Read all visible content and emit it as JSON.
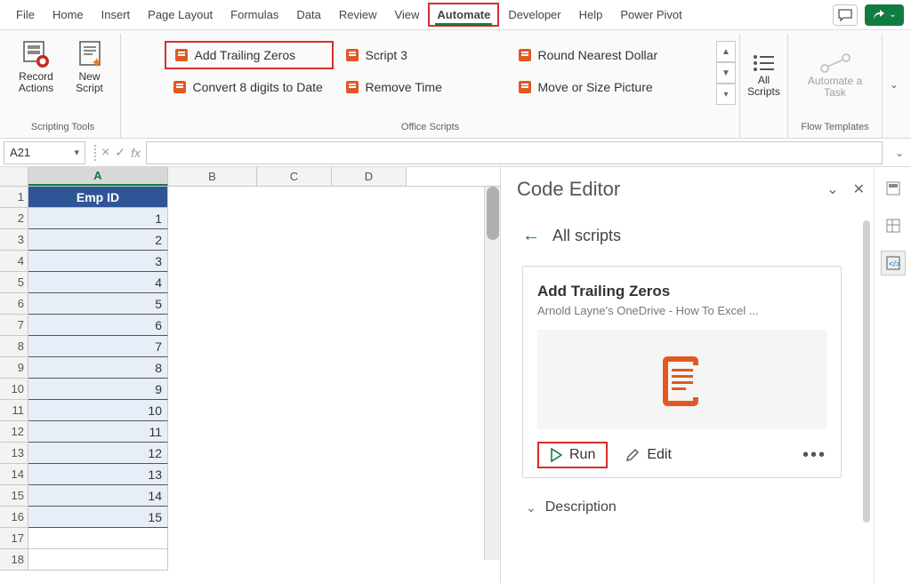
{
  "tabs": {
    "file": "File",
    "home": "Home",
    "insert": "Insert",
    "pagelayout": "Page Layout",
    "formulas": "Formulas",
    "data": "Data",
    "review": "Review",
    "view": "View",
    "automate": "Automate",
    "developer": "Developer",
    "help": "Help",
    "powerpivot": "Power Pivot"
  },
  "ribbon": {
    "record": "Record Actions",
    "newscript": "New Script",
    "scripts": {
      "addTrailing": "Add Trailing Zeros",
      "convert8": "Convert 8 digits to Date",
      "script3": "Script 3",
      "removeTime": "Remove Time",
      "roundNearest": "Round Nearest Dollar",
      "moveSize": "Move or Size Picture"
    },
    "allScripts": "All Scripts",
    "automateTask": "Automate a Task",
    "groups": {
      "scriptingTools": "Scripting Tools",
      "officeScripts": "Office Scripts",
      "flowTemplates": "Flow Templates"
    }
  },
  "namebox": "A21",
  "sheet": {
    "cols": {
      "A": "A",
      "B": "B",
      "C": "C",
      "D": "D"
    },
    "header": "Emp ID",
    "rows": {
      "r1": "1",
      "r2": "2",
      "r3": "3",
      "r4": "4",
      "r5": "5",
      "r6": "6",
      "r7": "7",
      "r8": "8",
      "r9": "9",
      "r10": "10",
      "r11": "11",
      "r12": "12",
      "r13": "13",
      "r14": "14",
      "r15": "15",
      "r16": "16",
      "r17": "17",
      "r18": "18"
    },
    "data": {
      "d2": "1",
      "d3": "2",
      "d4": "3",
      "d5": "4",
      "d6": "5",
      "d7": "6",
      "d8": "7",
      "d9": "8",
      "d10": "9",
      "d11": "10",
      "d12": "11",
      "d13": "12",
      "d14": "13",
      "d15": "14",
      "d16": "15"
    }
  },
  "pane": {
    "title": "Code Editor",
    "allScripts": "All scripts",
    "cardTitle": "Add Trailing Zeros",
    "cardSub": "Arnold Layne's OneDrive - How To Excel ...",
    "run": "Run",
    "edit": "Edit",
    "description": "Description"
  }
}
